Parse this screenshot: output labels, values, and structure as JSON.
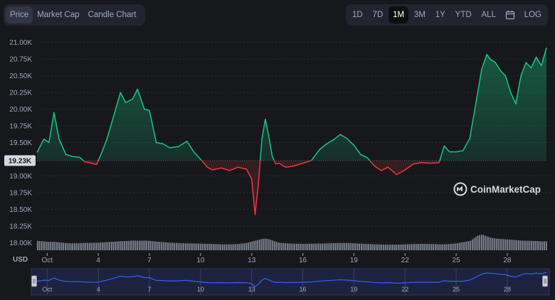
{
  "toolbar": {
    "tabs": [
      {
        "label": "Price",
        "active": true
      },
      {
        "label": "Market Cap",
        "active": false
      },
      {
        "label": "Candle Chart",
        "active": false
      }
    ],
    "ranges": [
      {
        "label": "1D",
        "active": false
      },
      {
        "label": "7D",
        "active": false
      },
      {
        "label": "1M",
        "active": true
      },
      {
        "label": "3M",
        "active": false
      },
      {
        "label": "1Y",
        "active": false
      },
      {
        "label": "YTD",
        "active": false
      },
      {
        "label": "ALL",
        "active": false
      }
    ],
    "calendar_icon": "calendar-icon",
    "log_label": "LOG"
  },
  "colors": {
    "up": "#16c784",
    "down": "#ea3943",
    "navigator_line": "#3861fb",
    "background": "#17181b"
  },
  "chart_data": {
    "type": "line",
    "currency_label": "USD",
    "baseline_value": "19.23K",
    "baseline": 19230,
    "ylim": [
      17950,
      21050
    ],
    "y_ticks": [
      {
        "value": 21000,
        "label": "21.00K"
      },
      {
        "value": 20750,
        "label": "20.75K"
      },
      {
        "value": 20500,
        "label": "20.50K"
      },
      {
        "value": 20250,
        "label": "20.25K"
      },
      {
        "value": 20000,
        "label": "20.00K"
      },
      {
        "value": 19750,
        "label": "19.75K"
      },
      {
        "value": 19500,
        "label": "19.50K"
      },
      {
        "value": 19000,
        "label": "19.00K"
      },
      {
        "value": 18750,
        "label": "18.75K"
      },
      {
        "value": 18500,
        "label": "18.50K"
      },
      {
        "value": 18250,
        "label": "18.25K"
      },
      {
        "value": 18000,
        "label": "18.00K"
      }
    ],
    "xlim": [
      0.4,
      30.3
    ],
    "x_ticks": [
      {
        "value": 1,
        "label": "Oct"
      },
      {
        "value": 4,
        "label": "4"
      },
      {
        "value": 7,
        "label": "7"
      },
      {
        "value": 10,
        "label": "10"
      },
      {
        "value": 13,
        "label": "13"
      },
      {
        "value": 16,
        "label": "16"
      },
      {
        "value": 19,
        "label": "19"
      },
      {
        "value": 22,
        "label": "22"
      },
      {
        "value": 25,
        "label": "25"
      },
      {
        "value": 28,
        "label": "28"
      }
    ],
    "x": [
      0.4,
      0.8,
      1.1,
      1.4,
      1.7,
      2.1,
      2.5,
      2.9,
      3.2,
      3.5,
      3.9,
      4.2,
      4.5,
      4.9,
      5.3,
      5.6,
      6.0,
      6.3,
      6.7,
      7.0,
      7.4,
      7.8,
      8.2,
      8.7,
      9.2,
      9.6,
      10.0,
      10.4,
      10.7,
      11.2,
      11.7,
      12.2,
      12.7,
      13.0,
      13.2,
      13.4,
      13.6,
      13.8,
      14.0,
      14.2,
      14.4,
      14.6,
      15.0,
      15.5,
      16.0,
      16.5,
      17.0,
      17.4,
      17.8,
      18.2,
      18.6,
      19.0,
      19.4,
      19.8,
      20.2,
      20.6,
      21.0,
      21.5,
      22.0,
      22.5,
      23.0,
      23.5,
      24.0,
      24.3,
      24.6,
      25.0,
      25.4,
      25.8,
      26.2,
      26.5,
      26.8,
      27.0,
      27.3,
      27.6,
      27.9,
      28.2,
      28.5,
      28.8,
      29.1,
      29.4,
      29.7,
      30.0,
      30.3
    ],
    "y": [
      19350,
      19550,
      19500,
      19950,
      19550,
      19320,
      19290,
      19280,
      19210,
      19200,
      19170,
      19350,
      19550,
      19900,
      20250,
      20100,
      20150,
      20300,
      20000,
      19980,
      19500,
      19480,
      19420,
      19440,
      19520,
      19360,
      19250,
      19130,
      19090,
      19120,
      19080,
      19130,
      19100,
      18950,
      18420,
      18900,
      19550,
      19850,
      19600,
      19300,
      19180,
      19190,
      19130,
      19150,
      19190,
      19230,
      19400,
      19480,
      19540,
      19620,
      19560,
      19460,
      19320,
      19270,
      19150,
      19080,
      19130,
      19020,
      19090,
      19180,
      19200,
      19190,
      19200,
      19450,
      19360,
      19360,
      19380,
      19560,
      20150,
      20600,
      20820,
      20750,
      20700,
      20580,
      20500,
      20250,
      20080,
      20500,
      20700,
      20620,
      20780,
      20650,
      20920
    ],
    "volume": [
      0.6,
      0.56,
      0.53,
      0.54,
      0.5,
      0.45,
      0.44,
      0.45,
      0.47,
      0.47,
      0.48,
      0.5,
      0.52,
      0.55,
      0.58,
      0.59,
      0.62,
      0.61,
      0.62,
      0.6,
      0.55,
      0.52,
      0.48,
      0.45,
      0.44,
      0.43,
      0.42,
      0.41,
      0.4,
      0.38,
      0.38,
      0.4,
      0.47,
      0.56,
      0.62,
      0.68,
      0.72,
      0.75,
      0.7,
      0.62,
      0.54,
      0.47,
      0.44,
      0.42,
      0.41,
      0.42,
      0.43,
      0.44,
      0.45,
      0.46,
      0.46,
      0.44,
      0.42,
      0.4,
      0.38,
      0.37,
      0.36,
      0.36,
      0.38,
      0.4,
      0.41,
      0.4,
      0.38,
      0.38,
      0.4,
      0.44,
      0.52,
      0.6,
      0.92,
      1.0,
      0.88,
      0.8,
      0.75,
      0.72,
      0.7,
      0.68,
      0.64,
      0.62,
      0.61,
      0.6,
      0.59,
      0.57,
      0.57
    ]
  },
  "watermark": {
    "text": "CoinMarketCap",
    "icon": "coinmarketcap-logo-icon"
  },
  "navigator": {
    "handle_left_icon": "drag-handle-icon",
    "handle_right_icon": "drag-handle-icon"
  }
}
